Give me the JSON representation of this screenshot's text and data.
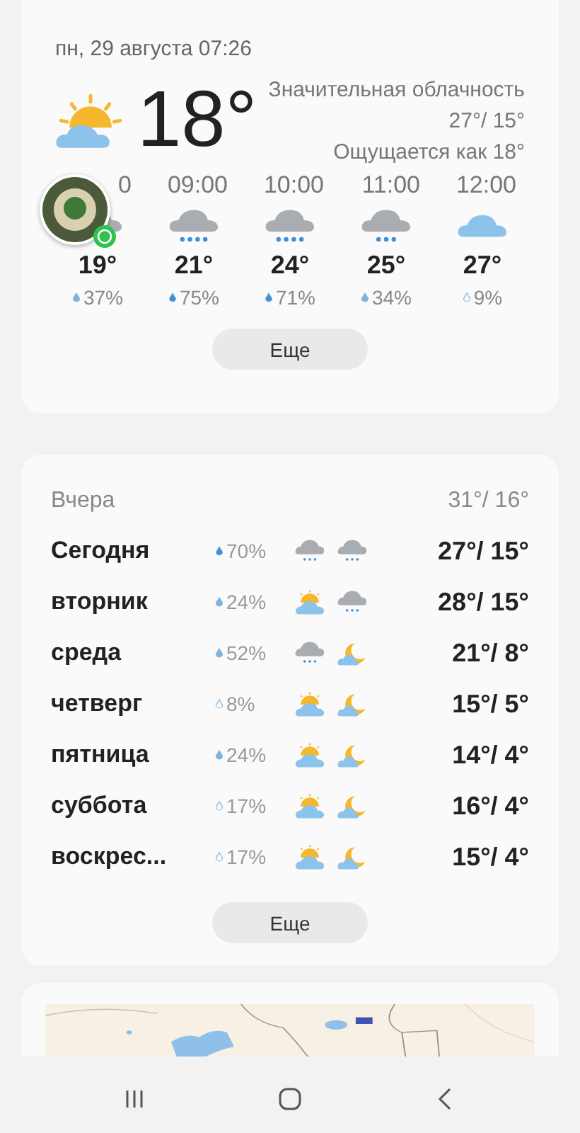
{
  "current": {
    "kind": "partly",
    "datetime": "пн, 29 августа 07:26",
    "temperature": "18°",
    "condition": "Значительная облачность",
    "high_low": "27°/ 15°",
    "feels_like": "Ощущается как 18°"
  },
  "hourly": [
    {
      "kind": "rain_light",
      "time": "0",
      "temp": "19°",
      "precip": {
        "kind": "half",
        "value": "37%"
      }
    },
    {
      "kind": "rain",
      "time": "09:00",
      "temp": "21°",
      "precip": {
        "kind": "full",
        "value": "75%"
      }
    },
    {
      "kind": "rain",
      "time": "10:00",
      "temp": "24°",
      "precip": {
        "kind": "full",
        "value": "71%"
      }
    },
    {
      "kind": "rain_light",
      "time": "11:00",
      "temp": "25°",
      "precip": {
        "kind": "half",
        "value": "34%"
      }
    },
    {
      "kind": "cloud",
      "time": "12:00",
      "temp": "27°",
      "precip": {
        "kind": "empty",
        "value": "9%"
      }
    }
  ],
  "hourly_more": "Еще",
  "chat_head": {
    "kind": "avatar"
  },
  "daily": {
    "yesterday": {
      "label": "Вчера",
      "temps": "31°/ 16°"
    },
    "days": [
      {
        "day": "Сегодня",
        "precip": {
          "kind": "full",
          "value": "70%"
        },
        "icons": [
          {
            "kind": "rain"
          },
          {
            "kind": "rain"
          }
        ],
        "temps": "27°/ 15°"
      },
      {
        "day": "вторник",
        "precip": {
          "kind": "half",
          "value": "24%"
        },
        "icons": [
          {
            "kind": "partly"
          },
          {
            "kind": "rain"
          }
        ],
        "temps": "28°/ 15°"
      },
      {
        "day": "среда",
        "precip": {
          "kind": "half",
          "value": "52%"
        },
        "icons": [
          {
            "kind": "rain"
          },
          {
            "kind": "night"
          }
        ],
        "temps": "21°/ 8°"
      },
      {
        "day": "четверг",
        "precip": {
          "kind": "empty",
          "value": "8%"
        },
        "icons": [
          {
            "kind": "partly"
          },
          {
            "kind": "night"
          }
        ],
        "temps": "15°/ 5°"
      },
      {
        "day": "пятница",
        "precip": {
          "kind": "half",
          "value": "24%"
        },
        "icons": [
          {
            "kind": "partly"
          },
          {
            "kind": "night"
          }
        ],
        "temps": "14°/ 4°"
      },
      {
        "day": "суббота",
        "precip": {
          "kind": "empty",
          "value": "17%"
        },
        "icons": [
          {
            "kind": "partly"
          },
          {
            "kind": "night"
          }
        ],
        "temps": "16°/ 4°"
      },
      {
        "day": "воскрес...",
        "precip": {
          "kind": "empty",
          "value": "17%"
        },
        "icons": [
          {
            "kind": "partly"
          },
          {
            "kind": "night"
          }
        ],
        "temps": "15°/ 4°"
      }
    ],
    "more": "Еще"
  },
  "nav_bar": [
    {
      "kind": "recents"
    },
    {
      "kind": "home"
    },
    {
      "kind": "back"
    }
  ]
}
